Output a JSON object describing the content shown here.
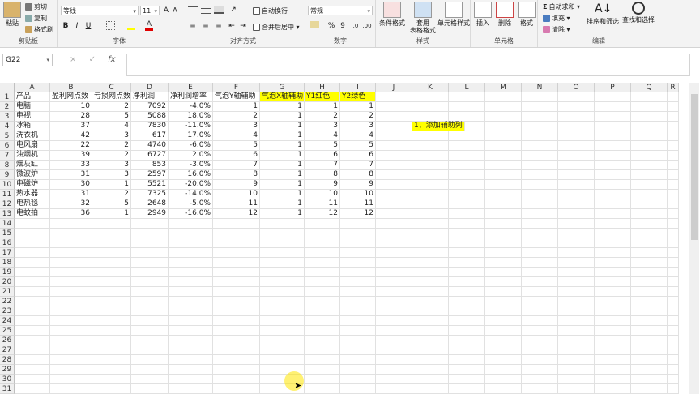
{
  "ribbon": {
    "clipboard": {
      "paste": "粘贴",
      "cut": "剪切",
      "copy": "复制",
      "format_painter": "格式刷",
      "label": "剪贴板"
    },
    "font": {
      "name": "等线",
      "size": "11",
      "grow": "A",
      "shrink": "A",
      "bold": "B",
      "italic": "I",
      "underline": "U",
      "font_color_letter": "A",
      "label": "字体"
    },
    "alignment": {
      "wrap": "自动换行",
      "merge": "合并后居中",
      "label": "对齐方式"
    },
    "number": {
      "format": "常规",
      "percent": "%",
      "comma": "9",
      "label": "数字"
    },
    "styles": {
      "conditional": "条件格式",
      "table_line1": "套用",
      "table_line2": "表格格式",
      "cell_styles": "单元格样式",
      "label": "样式"
    },
    "cells": {
      "insert": "插入",
      "delete": "删除",
      "format": "格式",
      "label": "单元格"
    },
    "editing": {
      "autosum": "自动求和",
      "fill": "填充",
      "clear": "清除",
      "sort_line1": "排序和筛选",
      "find_line1": "查找和选择",
      "label": "编辑"
    }
  },
  "formula_bar": {
    "name_box": "G22",
    "fx": "fx",
    "cancel": "×",
    "enter": "✓",
    "formula": ""
  },
  "columns": [
    "A",
    "B",
    "C",
    "D",
    "E",
    "F",
    "G",
    "H",
    "I",
    "J",
    "K",
    "L",
    "M",
    "N",
    "O",
    "P",
    "Q",
    "R"
  ],
  "rows": [
    "1",
    "2",
    "3",
    "4",
    "5",
    "6",
    "7",
    "8",
    "9",
    "10",
    "11",
    "12",
    "13",
    "14",
    "15",
    "16",
    "17",
    "18",
    "19",
    "20",
    "21",
    "22",
    "23",
    "24",
    "25",
    "26",
    "27",
    "28",
    "29",
    "30",
    "31"
  ],
  "headers": [
    "产品",
    "盈利网点数",
    "亏损网点数",
    "净利润",
    "净利润增率",
    "气泡Y轴辅助",
    "气泡X轴辅助",
    "Y1红色",
    "Y2绿色"
  ],
  "table": [
    [
      "电脑",
      "10",
      "2",
      "7092",
      "-4.0%",
      "1",
      "1",
      "1",
      "1"
    ],
    [
      "电视",
      "28",
      "5",
      "5088",
      "18.0%",
      "2",
      "1",
      "2",
      "2"
    ],
    [
      "冰箱",
      "37",
      "4",
      "7830",
      "-11.0%",
      "3",
      "1",
      "3",
      "3"
    ],
    [
      "洗衣机",
      "42",
      "3",
      "617",
      "17.0%",
      "4",
      "1",
      "4",
      "4"
    ],
    [
      "电风扇",
      "22",
      "2",
      "4740",
      "-6.0%",
      "5",
      "1",
      "5",
      "5"
    ],
    [
      "油烟机",
      "39",
      "2",
      "6727",
      "2.0%",
      "6",
      "1",
      "6",
      "6"
    ],
    [
      "烟灰缸",
      "33",
      "3",
      "853",
      "-3.0%",
      "7",
      "1",
      "7",
      "7"
    ],
    [
      "微波炉",
      "31",
      "3",
      "2597",
      "16.0%",
      "8",
      "1",
      "8",
      "8"
    ],
    [
      "电磁炉",
      "30",
      "1",
      "5521",
      "-20.0%",
      "9",
      "1",
      "9",
      "9"
    ],
    [
      "热水器",
      "31",
      "2",
      "7325",
      "-14.0%",
      "10",
      "1",
      "10",
      "10"
    ],
    [
      "电热毯",
      "32",
      "5",
      "2648",
      "-5.0%",
      "11",
      "1",
      "11",
      "11"
    ],
    [
      "电蚊拍",
      "36",
      "1",
      "2949",
      "-16.0%",
      "12",
      "1",
      "12",
      "12"
    ]
  ],
  "note": "1、添加辅助列",
  "colors": {
    "highlight": "#ffff00",
    "ribbon_bg": "#f3f3f3",
    "header_bg": "#efefef"
  }
}
